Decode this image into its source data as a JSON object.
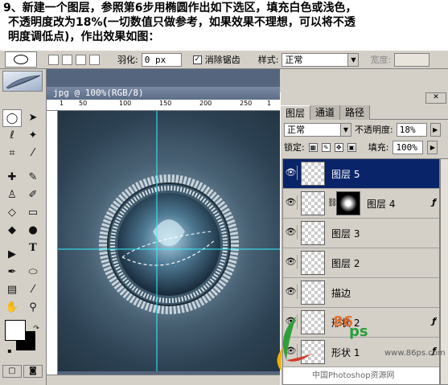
{
  "instruction": {
    "line1": "9、新建一个图层，参照第6步用椭圆作出如下选区，填充白色或浅色，",
    "line2": "不透明度改为18%(一切数值只做参考，如果效果不理想，可以将不透",
    "line3": "明度调低点)，作出效果如图："
  },
  "options_bar": {
    "feather_label": "羽化:",
    "feather_value": "0 px",
    "antialias_label": "消除锯齿",
    "antialias_checked": true,
    "style_label": "样式:",
    "style_value": "正常",
    "width_label": "宽度:"
  },
  "document": {
    "title": "jpg @ 100%(RGB/8)",
    "ruler_marks": [
      "1",
      "50",
      "100",
      "150",
      "200",
      "250",
      "1"
    ]
  },
  "layers_panel": {
    "tabs": [
      "图层",
      "通道",
      "路径"
    ],
    "active_tab": "图层",
    "blend_mode": "正常",
    "opacity_label": "不透明度:",
    "opacity_value": "18%",
    "lock_label": "锁定:",
    "fill_label": "填充:",
    "fill_value": "100%",
    "layers": [
      {
        "name": "图层 5",
        "selected": true,
        "visible": true,
        "has_mask": false,
        "has_fx": false
      },
      {
        "name": "图层 4",
        "selected": false,
        "visible": true,
        "has_mask": true,
        "has_fx": true
      },
      {
        "name": "图层 3",
        "selected": false,
        "visible": true,
        "has_mask": false,
        "has_fx": false
      },
      {
        "name": "图层 2",
        "selected": false,
        "visible": true,
        "has_mask": false,
        "has_fx": false
      },
      {
        "name": "描边",
        "selected": false,
        "visible": true,
        "has_mask": false,
        "has_fx": false
      },
      {
        "name": "形状 2",
        "selected": false,
        "visible": true,
        "has_mask": false,
        "has_fx": true
      },
      {
        "name": "形状 1",
        "selected": false,
        "visible": true,
        "has_mask": false,
        "has_fx": true
      }
    ]
  },
  "watermark": {
    "site": "www.86ps.com",
    "brand_text": "中国Photoshop资源网",
    "logo_digits": "86",
    "logo_letters": "ps"
  },
  "colors": {
    "selection_highlight": "#0a246a",
    "canvas_bg": "#55657e",
    "guide_line": "#35f0ff"
  }
}
